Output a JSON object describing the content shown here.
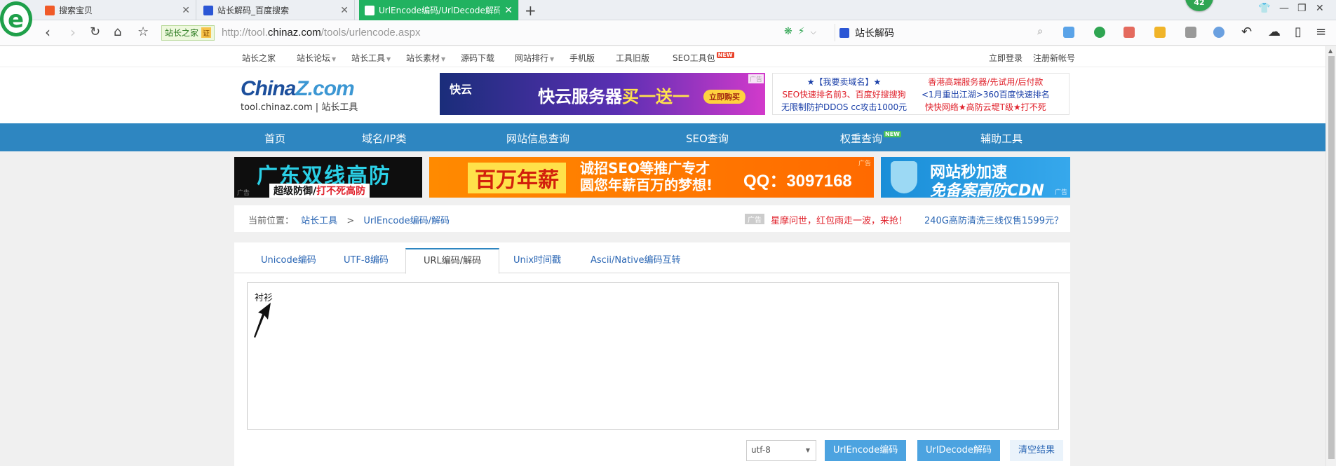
{
  "browser": {
    "tabs": [
      {
        "title": "搜索宝贝",
        "active": false
      },
      {
        "title": "站长解码_百度搜索",
        "active": false
      },
      {
        "title": "UrlEncode编码/UrlDecode解码",
        "active": true
      }
    ],
    "new_tab": "+",
    "badge": "42",
    "site_tag": "站长之家",
    "site_cert": "证",
    "url_prefix": "http://tool.",
    "url_domain": "chinaz.com",
    "url_path": "/tools/urlencode.aspx",
    "search_query": "站长解码"
  },
  "topnav": {
    "items": [
      "站长之家",
      "站长论坛",
      "站长工具",
      "站长素材",
      "源码下载",
      "网站排行",
      "手机版",
      "工具旧版",
      "SEO工具包"
    ],
    "new_badge": "NEW",
    "login": "立即登录",
    "register": "注册新帐号"
  },
  "header": {
    "logo_brand_a": "China",
    "logo_brand_b": "Z",
    "logo_brand_c": ".com",
    "logo_sub": "tool.chinaz.com | 站长工具",
    "ad_label": "广告",
    "ad1": {
      "brand": "快云",
      "slogan_a": "快云服务器",
      "slogan_b": "买一送一",
      "button": "立即购买"
    },
    "ad2": {
      "left": [
        "★【我要卖域名】★",
        "SEO快速排名前3、百度好搜搜狗",
        "无限制防护DDOS cc攻击1000元"
      ],
      "right": [
        "香港高端服务器/先试用/后付款",
        "<1月重出江湖>360百度快速排名",
        "快快网络★高防云堤T级★打不死"
      ]
    }
  },
  "mainnav": {
    "items": [
      "首页",
      "域名/IP类",
      "网站信息查询",
      "SEO查询",
      "权重查询",
      "辅助工具"
    ],
    "new_badge": "NEW"
  },
  "banners": {
    "b1_title": "广东双线高防",
    "b1_sub_a": "超级防御/",
    "b1_sub_b": "打不死高防",
    "b2_big": "百万年薪",
    "b2_mid_a": "诚招SEO等推广专才",
    "b2_mid_b": "圆您年薪百万的梦想!",
    "b2_qq": "QQ：3097168",
    "b3_title": "网站秒加速",
    "b3_sub": "免备案高防CDN"
  },
  "breadcrumb": {
    "label": "当前位置：",
    "crumb1": "站长工具",
    "separator": ">",
    "crumb2": "UrlEncode编码/解码",
    "ad_label": "广告",
    "promo1": "星摩问世，红包雨走一波，来抢！",
    "promo2": "240G高防清洗三线仅售1599元？"
  },
  "tool": {
    "tabs": [
      "Unicode编码",
      "UTF-8编码",
      "URL编码/解码",
      "Unix时间戳",
      "Ascii/Native编码互转"
    ],
    "active_tab": 2,
    "input_value": "衬衫",
    "charset_selected": "utf-8",
    "encode_button": "UrlEncode编码",
    "decode_button": "UrlDecode解码",
    "clear_button": "清空结果"
  },
  "colors": {
    "accent_blue": "#2e86c1",
    "active_tab_green": "#21b260",
    "link_blue": "#2a66b4",
    "promo_red": "#e0202a",
    "button_blue": "#4ca3e0"
  }
}
